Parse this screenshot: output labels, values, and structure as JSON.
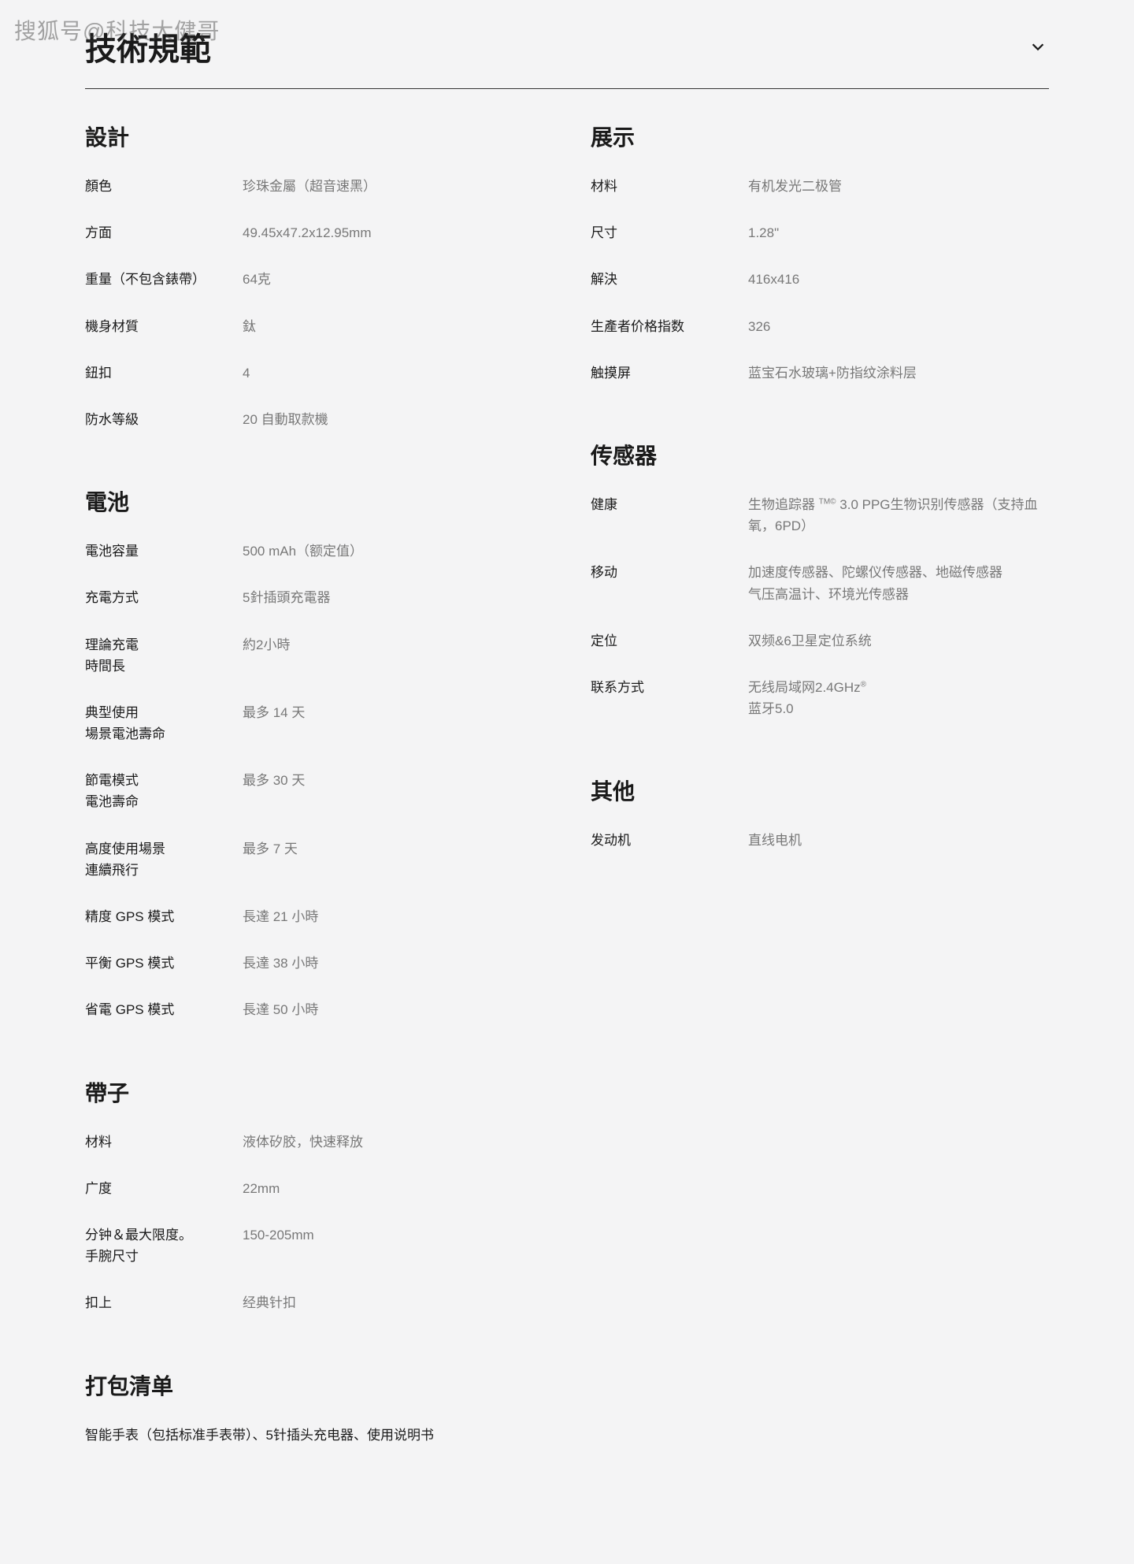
{
  "watermark": "搜狐号@科技大健哥",
  "page_title": "技術規範",
  "left_sections": [
    {
      "title": "設計",
      "rows": [
        {
          "label": "顏色",
          "value": "珍珠金屬（超音速黑）"
        },
        {
          "label": "方面",
          "value": "49.45x47.2x12.95mm"
        },
        {
          "label": "重量（不包含錶帶）",
          "value": "64克"
        },
        {
          "label": "機身材質",
          "value": "鈦"
        },
        {
          "label": "鈕扣",
          "value": "4"
        },
        {
          "label": "防水等級",
          "value": "20 自動取款機"
        }
      ]
    },
    {
      "title": "電池",
      "rows": [
        {
          "label": "電池容量",
          "value": "500 mAh（额定值）"
        },
        {
          "label": "充電方式",
          "value": "5針插頭充電器"
        },
        {
          "label": "理論充電\n時間長",
          "value": "約2小時"
        },
        {
          "label": "典型使用\n場景電池壽命",
          "value": "最多 14 天"
        },
        {
          "label": "節電模式\n電池壽命",
          "value": "最多 30 天"
        },
        {
          "label": "高度使用場景\n連續飛行",
          "value": "最多 7 天"
        },
        {
          "label": "精度 GPS 模式",
          "value": "長達 21 小時"
        },
        {
          "label": "平衡 GPS 模式",
          "value": "長達 38 小時"
        },
        {
          "label": "省電 GPS 模式",
          "value": "長達 50 小時"
        }
      ]
    },
    {
      "title": "帶子",
      "rows": [
        {
          "label": "材料",
          "value": "液体矽胶，快速释放"
        },
        {
          "label": "广度",
          "value": "22mm"
        },
        {
          "label": "分钟＆最大限度。\n手腕尺寸",
          "value": "150-205mm"
        },
        {
          "label": "扣上",
          "value": "经典针扣"
        }
      ]
    },
    {
      "title": "打包清单",
      "rows": [
        {
          "label_full": "智能手表（包括标准手表带）、5针插头充电器、使用说明书"
        }
      ]
    }
  ],
  "right_sections": [
    {
      "title": "展示",
      "rows": [
        {
          "label": "材料",
          "value": "有机发光二极管"
        },
        {
          "label": "尺寸",
          "value": "1.28\""
        },
        {
          "label": "解決",
          "value": "416x416"
        },
        {
          "label": "生產者价格指数",
          "value": "326"
        },
        {
          "label": "触摸屏",
          "value": "蓝宝石水玻璃+防指纹涂料层"
        }
      ]
    },
    {
      "title": "传感器",
      "rows": [
        {
          "label": "健康",
          "value_html": "生物追踪器 <span class='tm'>TM©</span> 3.0 PPG生物识别传感器（支持血氧，6PD）"
        },
        {
          "label": "移动",
          "value": "加速度传感器、陀螺仪传感器、地磁传感器\n气压高温计、环境光传感器"
        },
        {
          "label": "定位",
          "value": "双频&6卫星定位系统"
        },
        {
          "label": "联系方式",
          "value_html": "无线局域网2.4GHz<span class='tm'>®</span>\n蓝牙5.0"
        }
      ]
    },
    {
      "title": "其他",
      "rows": [
        {
          "label": "发动机",
          "value": "直线电机"
        }
      ]
    }
  ]
}
